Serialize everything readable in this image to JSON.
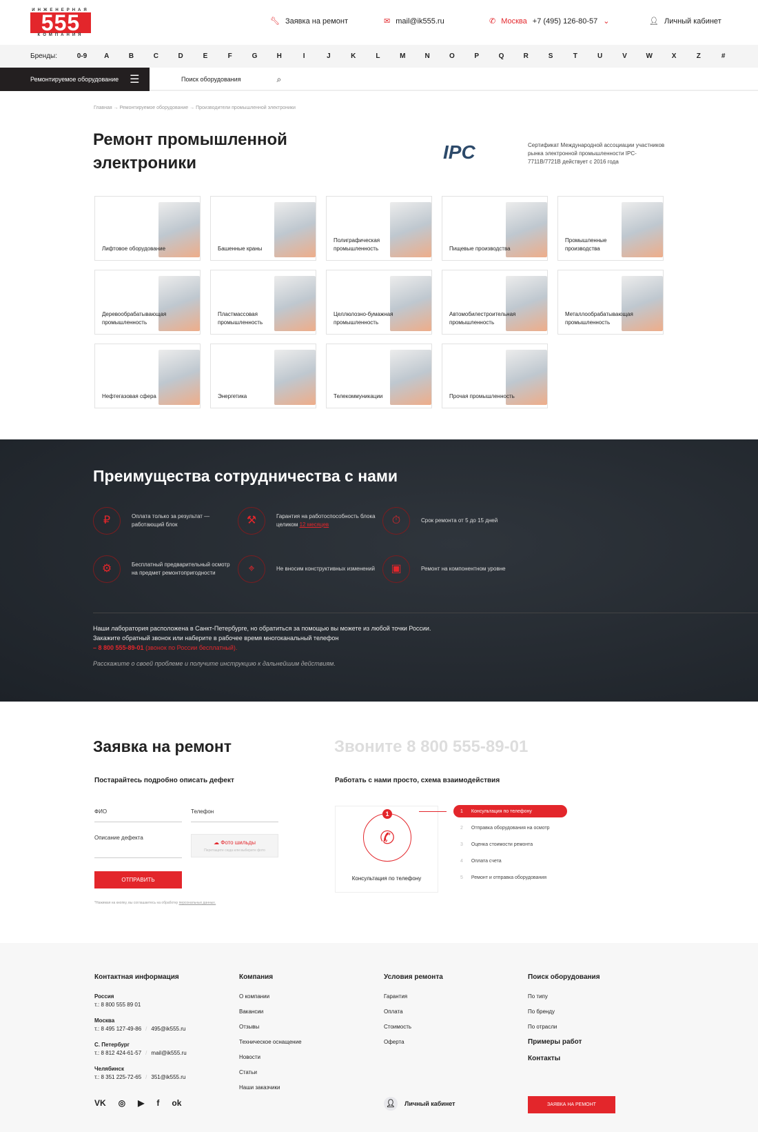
{
  "header": {
    "logo_top": "ИНЖЕНЕРНАЯ",
    "logo_num": "555",
    "logo_bottom": "КОМПАНИЯ",
    "repair_request": "Заявка на ремонт",
    "email": "mail@ik555.ru",
    "city": "Москва",
    "phone": "+7 (495) 126-80-57",
    "account": "Личный кабинет"
  },
  "brands": {
    "label": "Бренды:",
    "letters": [
      "0-9",
      "A",
      "B",
      "C",
      "D",
      "E",
      "F",
      "G",
      "H",
      "I",
      "J",
      "K",
      "L",
      "M",
      "N",
      "O",
      "P",
      "Q",
      "R",
      "S",
      "T",
      "U",
      "V",
      "W",
      "X",
      "Z",
      "#"
    ]
  },
  "nav": {
    "catalog": "Ремонтируемое оборудование",
    "search_placeholder": "Поиск оборудования"
  },
  "breadcrumb": "Главная  →  Ремонтируемое оборудование  →  Производители промышленной электроники",
  "page_title": "Ремонт промышленной электроники",
  "certificate": {
    "logo": "IPC",
    "text": "Сертификат Международной ассоциации участников рынка электронной промышленности IPC-7711B/7721B действует с 2016 года"
  },
  "categories": [
    "Лифтовое оборудование",
    "Башенные краны",
    "Полиграфическая промышленность",
    "Пищевые производства",
    "Промышленные производства",
    "Деревообрабатывающая промышленность",
    "Пластмассовая промышленность",
    "Целлюлозно-бумажная промышленность",
    "Автомобилестроительная промышленность",
    "Металлообрабатывающая промышленность",
    "Нефтегазовая сфера",
    "Энергетика",
    "Телекоммуникации",
    "Прочая промышленность"
  ],
  "advantages": {
    "title": "Преимущества сотрудничества с нами",
    "items": [
      {
        "text": "Оплата только за результат — работающий блок",
        "icon": "payment-icon"
      },
      {
        "text": "Гарантия на работоспособность блока целиком ",
        "link": "12 месяцев",
        "icon": "warranty-icon"
      },
      {
        "text": "Срок ремонта от 5 до 15 дней",
        "icon": "timer-icon"
      },
      {
        "text": "Бесплатный предварительный осмотр на предмет ремонтопригодности",
        "icon": "inspection-icon"
      },
      {
        "text": "Не вносим конструктивных изменений",
        "icon": "target-icon"
      },
      {
        "text": "Ремонт на компонентном уровне",
        "icon": "chip-icon"
      }
    ],
    "p1": "Наши лаборатория расположена в Санкт-Петербурге, но обратиться за помощью вы можете из любой точки России.",
    "p2": "Закажите обратный звонок или наберите в рабочее время многоканальный телефон",
    "phone": "– 8 800 555-89-01",
    "phone_note": " (звонок по России бесплатный).",
    "italic": "Расскажите о своей проблеме и получите инструкцию к дальнейшим действиям."
  },
  "form": {
    "title": "Заявка на ремонт",
    "call": "Звоните 8 800 555-89-01",
    "subtitle": "Постарайтесь подробно описать дефект",
    "name_placeholder": "ФИО",
    "phone_placeholder": "Телефон",
    "defect_placeholder": "Описание дефекта",
    "upload_label": "Фото шильды",
    "upload_hint": "Перетащите сюда или выберите фото",
    "submit": "ОТПРАВИТЬ",
    "agree": "*Нажимая на кнопку, вы соглашаетесь на обработку ",
    "agree_link": "персональных данных."
  },
  "scheme": {
    "title": "Работать с нами просто, схема взаимодействия",
    "active_caption": "Консультация по телефону",
    "active_number": "1",
    "steps": [
      {
        "n": "1",
        "label": "Консультация по телефону"
      },
      {
        "n": "2",
        "label": "Отправка оборудования на осмотр"
      },
      {
        "n": "3",
        "label": "Оценка стоимости ремонта"
      },
      {
        "n": "4",
        "label": "Оплата счета"
      },
      {
        "n": "5",
        "label": "Ремонт и отправка оборудования"
      }
    ]
  },
  "footer": {
    "contacts": {
      "title": "Контактная информация",
      "items": [
        {
          "city": "Россия",
          "phone": "т.: 8 800 555 89 01"
        },
        {
          "city": "Москва",
          "phone": "т.: 8 495 127-49-86",
          "email": "495@ik555.ru"
        },
        {
          "city": "С. Петербург",
          "phone": "т.: 8 812 424-61-57",
          "email": "mail@ik555.ru"
        },
        {
          "city": "Челябинск",
          "phone": "т.: 8 351 225-72-65",
          "email": "351@ik555.ru"
        }
      ]
    },
    "company": {
      "title": "Компания",
      "links": [
        "О компании",
        "Вакансии",
        "Отзывы",
        "Техническое оснащение",
        "Новости",
        "Статьи",
        "Наши заказчики"
      ]
    },
    "terms": {
      "title": "Условия ремонта",
      "links": [
        "Гарантия",
        "Оплата",
        "Стоимость",
        "Оферта"
      ]
    },
    "search": {
      "title": "Поиск оборудования",
      "links": [
        "По типу",
        "По бренду",
        "По отрасли"
      ],
      "examples": "Примеры работ",
      "contacts": "Контакты"
    },
    "social": {
      "vk": "VK",
      "instagram": "◎",
      "youtube": "▶",
      "facebook": "f",
      "ok": "ok"
    },
    "account": "Личный кабинет",
    "cta": "ЗАЯВКА НА РЕМОНТ"
  },
  "colors": {
    "accent": "#e3262b",
    "dark": "#1d2228"
  }
}
